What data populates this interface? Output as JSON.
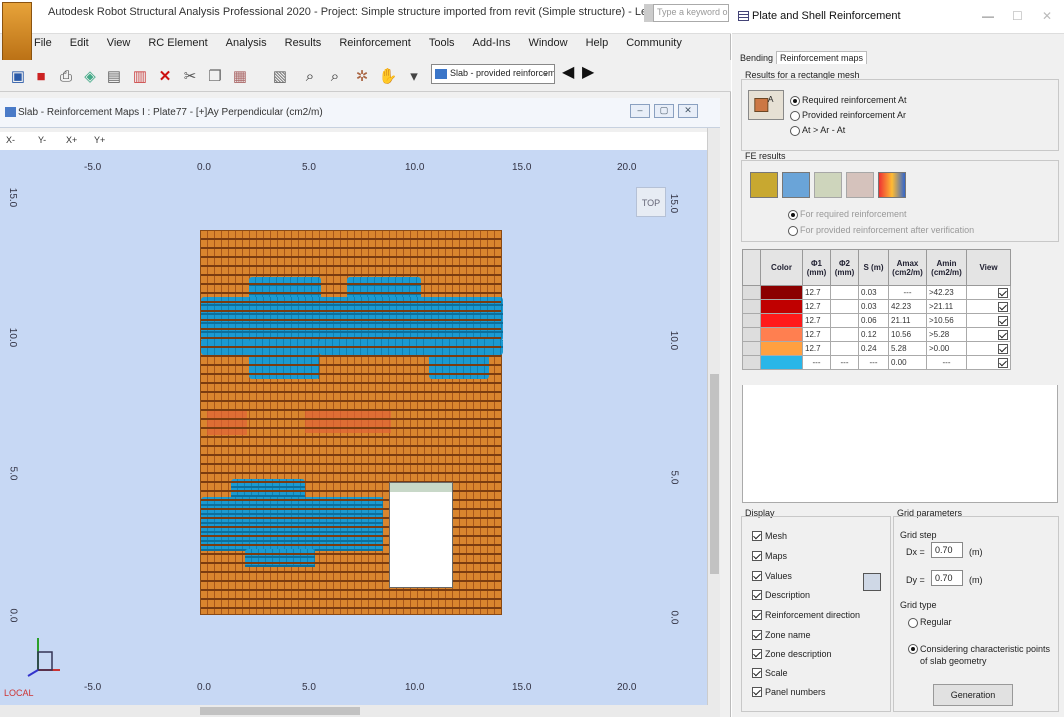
{
  "app": {
    "title": "Autodesk Robot Structural Analysis Professional 2020 - Project: Simple structure imported from revit (Simple structure) - Level: Level ...",
    "search_placeholder": "Type a keyword or phrase",
    "menu": [
      "File",
      "Edit",
      "View",
      "RC Element",
      "Analysis",
      "Results",
      "Reinforcement",
      "Tools",
      "Add-Ins",
      "Window",
      "Help",
      "Community"
    ],
    "toolbar_select": "Slab - provided reinforcement",
    "doc_title": "Slab - Reinforcement Maps I : Plate77 - [+]Ay Perpendicular (cm2/m)",
    "view_tabs": [
      "X-",
      "Y-",
      "X+",
      "Y+"
    ],
    "top_ticks": [
      "-5.0",
      "0.0",
      "5.0",
      "10.0",
      "15.0",
      "20.0"
    ],
    "bottom_ticks": [
      "-5.0",
      "0.0",
      "5.0",
      "10.0",
      "15.0",
      "20.0"
    ],
    "left_ticks": [
      "15.0",
      "10.0",
      "5.0",
      "0.0"
    ],
    "right_ticks": [
      "15.0",
      "10.0",
      "5.0",
      "0.0"
    ],
    "view_cube": "TOP",
    "local_label": "LOCAL"
  },
  "dialog": {
    "title": "Plate and Shell Reinforcement",
    "tabs": [
      "Bending",
      "Reinforcement maps"
    ],
    "results_label": "Results for a rectangle mesh",
    "results_options": [
      "Required reinforcement At",
      "Provided reinforcement Ar",
      "At > Ar - At"
    ],
    "fe_label": "FE results",
    "fe_options": [
      "For required reinforcement",
      "For provided reinforcement after verification"
    ],
    "table_headers": [
      "Color",
      "Φ1 (mm)",
      "Φ2 (mm)",
      "S (m)",
      "Amax (cm2/m)",
      "Amin (cm2/m)",
      "View"
    ],
    "rows": [
      {
        "color": "#8b0000",
        "phi1": "12.7",
        "phi2": "",
        "s": "0.03",
        "amax": "---",
        "amin": ">42.23"
      },
      {
        "color": "#c00000",
        "phi1": "12.7",
        "phi2": "",
        "s": "0.03",
        "amax": "42.23",
        "amin": ">21.11"
      },
      {
        "color": "#ff1a1a",
        "phi1": "12.7",
        "phi2": "",
        "s": "0.06",
        "amax": "21.11",
        "amin": ">10.56"
      },
      {
        "color": "#ff7f50",
        "phi1": "12.7",
        "phi2": "",
        "s": "0.12",
        "amax": "10.56",
        "amin": ">5.28"
      },
      {
        "color": "#ffa040",
        "phi1": "12.7",
        "phi2": "",
        "s": "0.24",
        "amax": "5.28",
        "amin": ">0.00"
      },
      {
        "color": "#29b6e8",
        "phi1": "---",
        "phi2": "---",
        "s": "---",
        "amax": "0.00",
        "amin": "---"
      }
    ],
    "display_label": "Display",
    "display_options": [
      "Mesh",
      "Maps",
      "Values",
      "Description",
      "Reinforcement direction",
      "Zone name",
      "Zone description",
      "Scale",
      "Panel numbers"
    ],
    "grid_label": "Grid parameters",
    "grid_step_label": "Grid step",
    "dx_label": "Dx =",
    "dx_value": "0.70",
    "dy_label": "Dy =",
    "dy_value": "0.70",
    "unit": "(m)",
    "grid_type_label": "Grid type",
    "grid_type_options": [
      "Regular",
      "Considering characteristic points of slab geometry"
    ],
    "generation_button": "Generation"
  }
}
